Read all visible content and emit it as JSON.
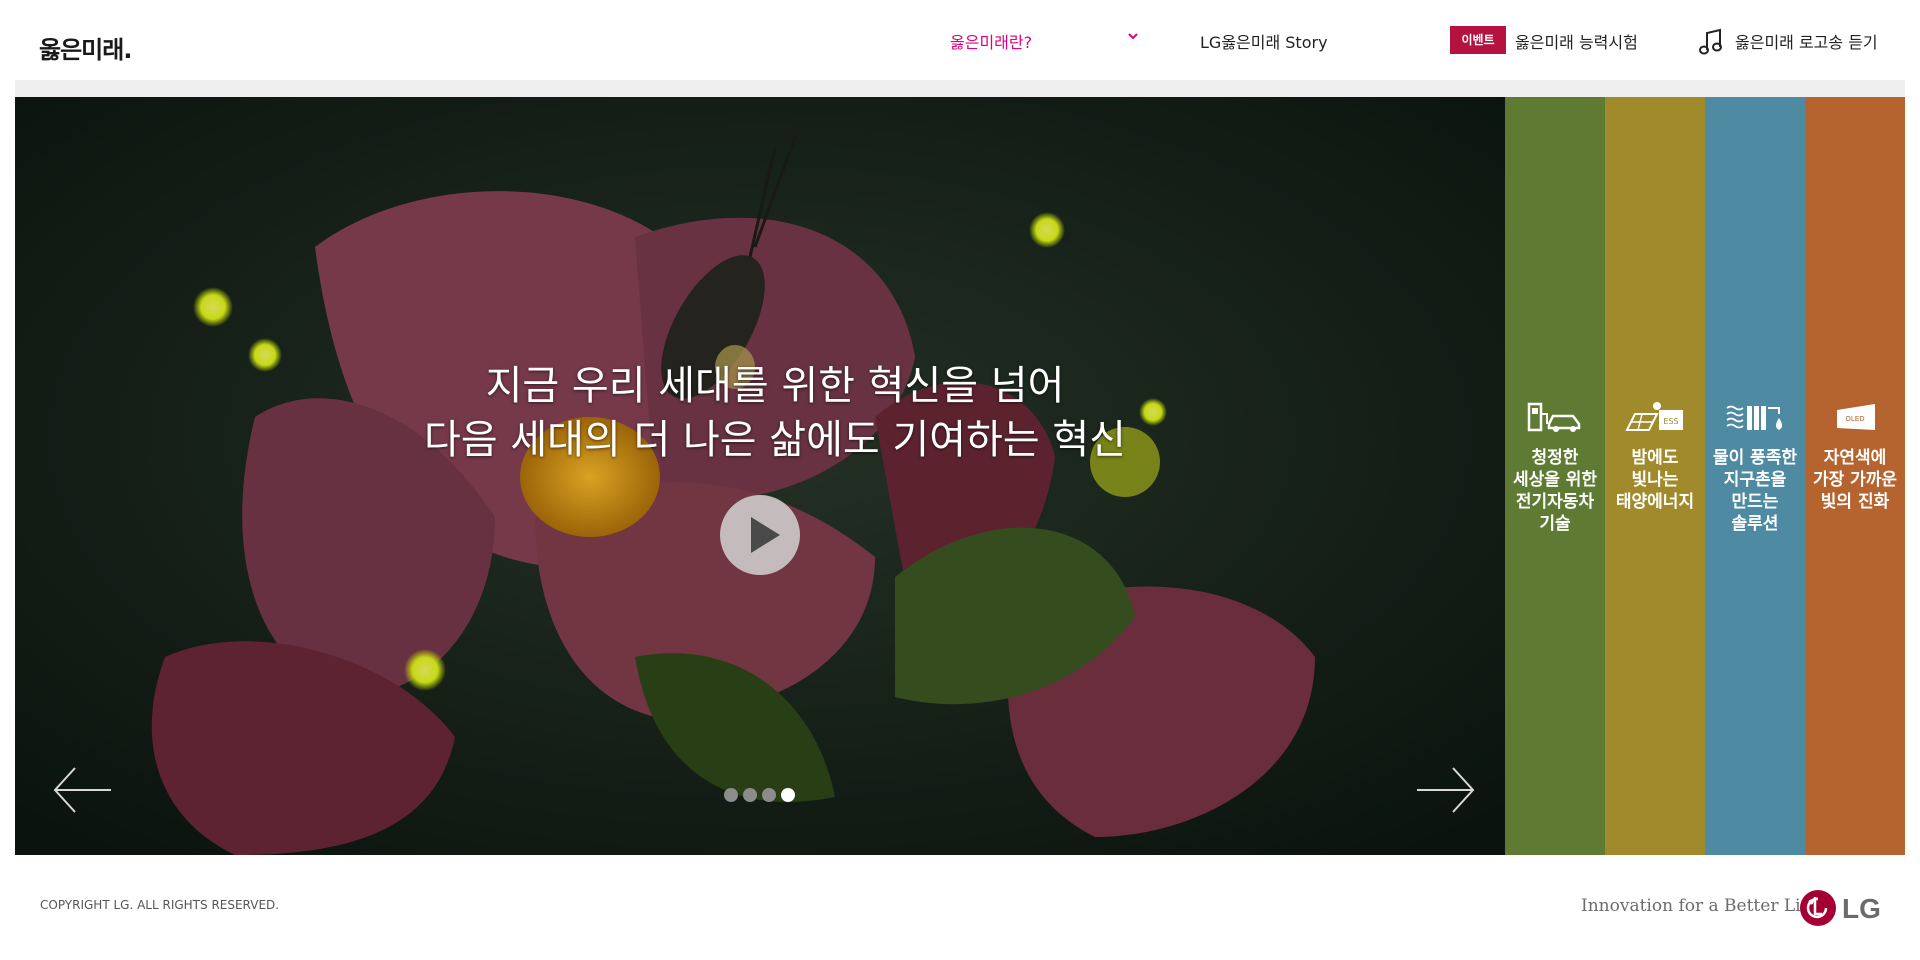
{
  "header": {
    "logo_text": "옳은미래.",
    "nav": {
      "about": "옳은미래란?",
      "story": "LG옳은미래 Story",
      "event_badge": "이벤트",
      "event_label": "옳은미래 능력시험",
      "song_label": "옳은미래 로고송 듣기"
    },
    "accent_color": "#e4007f",
    "badge_color": "#b5123f"
  },
  "hero": {
    "headline_line1": "지금 우리 세대를 위한 혁신을 넘어",
    "headline_line2": "다음 세대의 더 나은 삶에도 기여하는 혁신",
    "slide_count": 4,
    "active_slide": 4
  },
  "panels": [
    {
      "line1": "청정한",
      "line2": "세상을 위한",
      "line3": "전기자동차",
      "line4": "기술",
      "color": "#5e7a33",
      "icon": "ev-charging-icon"
    },
    {
      "line1": "밤에도",
      "line2": "빛나는",
      "line3": "태양에너지",
      "line4": "",
      "color": "#a18a2b",
      "icon": "solar-ess-icon"
    },
    {
      "line1": "물이 풍족한",
      "line2": "지구촌을",
      "line3": "만드는",
      "line4": "솔루션",
      "color": "#4f8aa3",
      "icon": "water-filter-icon"
    },
    {
      "line1": "자연색에",
      "line2": "가장 가까운",
      "line3": "빛의 진화",
      "line4": "",
      "color": "#b5632f",
      "icon": "oled-icon"
    }
  ],
  "footer": {
    "copyright": "COPYRIGHT LG. ALL RIGHTS RESERVED.",
    "slogan": "Innovation for a Better Life",
    "brand": "LG",
    "brand_color": "#a50034"
  }
}
